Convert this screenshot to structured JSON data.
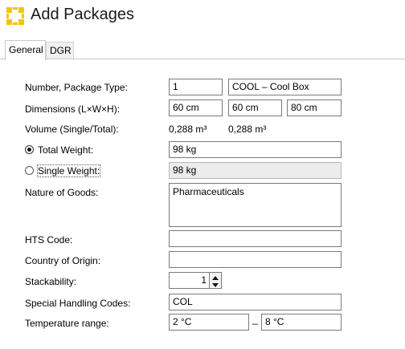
{
  "window": {
    "title": "Add Packages",
    "logo_icon": "dhl-bracket-logo",
    "accent": "#f2c500"
  },
  "tabs": [
    {
      "label": "General",
      "active": true
    },
    {
      "label": "DGR",
      "active": false
    }
  ],
  "form": {
    "number_package_type": {
      "label": "Number, Package Type:",
      "number": "1",
      "type": "COOL – Cool Box"
    },
    "dimensions": {
      "label": "Dimensions (L×W×H):",
      "l": "60 cm",
      "w": "60 cm",
      "h": "80 cm"
    },
    "volume": {
      "label": "Volume (Single/Total):",
      "single": "0,288 m³",
      "total": "0,288 m³"
    },
    "total_weight": {
      "label": "Total Weight:",
      "value": "98 kg",
      "selected": true
    },
    "single_weight": {
      "label": "Single Weight:",
      "value": "98 kg",
      "selected": false
    },
    "nature_of_goods": {
      "label": "Nature of Goods:",
      "value": "Pharmaceuticals"
    },
    "hts_code": {
      "label": "HTS Code:",
      "value": ""
    },
    "country_of_origin": {
      "label": "Country of Origin:",
      "value": ""
    },
    "stackability": {
      "label": "Stackability:",
      "value": "1"
    },
    "special_handling": {
      "label": "Special Handling Codes:",
      "value": "COL"
    },
    "temperature": {
      "label": "Temperature range:",
      "from": "2 °C",
      "separator": "–",
      "to": "8 °C"
    }
  }
}
